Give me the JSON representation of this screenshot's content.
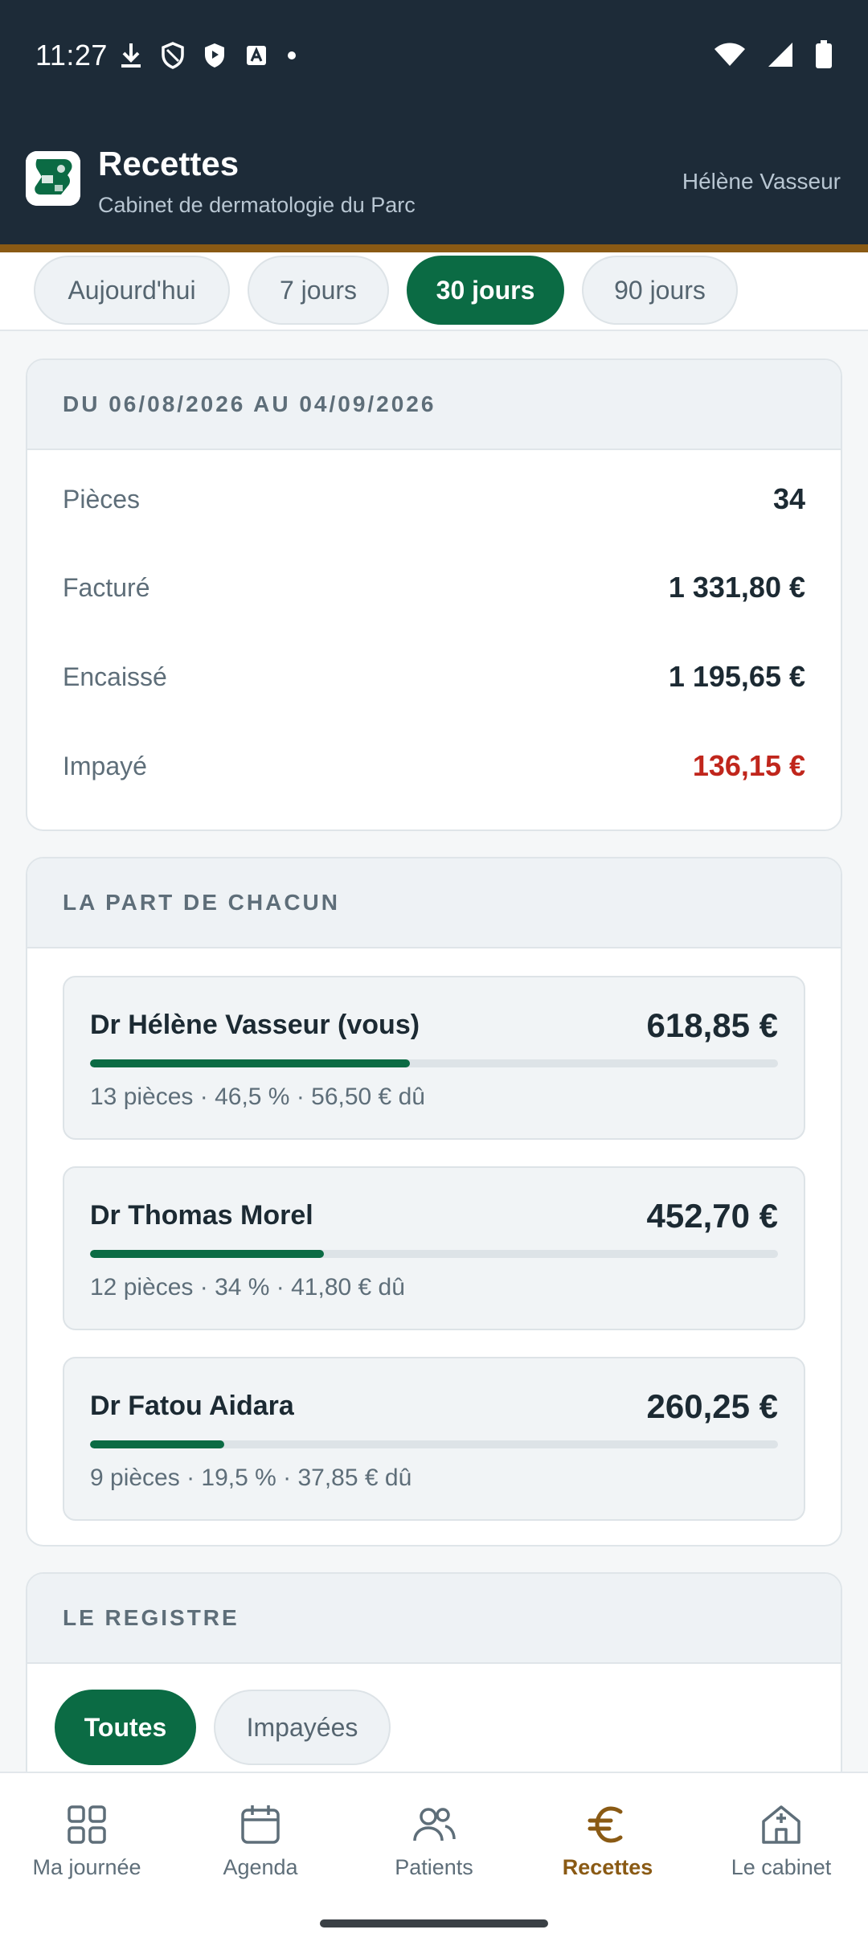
{
  "status_bar": {
    "time": "11:27"
  },
  "header": {
    "title": "Recettes",
    "subtitle": "Cabinet de dermatologie du Parc",
    "user": "Hélène Vasseur"
  },
  "periods": [
    {
      "label": "Aujourd'hui",
      "active": false
    },
    {
      "label": "7 jours",
      "active": false
    },
    {
      "label": "30 jours",
      "active": true
    },
    {
      "label": "90 jours",
      "active": false
    }
  ],
  "summary": {
    "heading": "DU 06/08/2026 AU 04/09/2026",
    "rows": [
      {
        "label": "Pièces",
        "value": "34"
      },
      {
        "label": "Facturé",
        "value": "1 331,80 €"
      },
      {
        "label": "Encaissé",
        "value": "1 195,65 €"
      },
      {
        "label": "Impayé",
        "value": "136,15 €"
      }
    ]
  },
  "shares": {
    "heading": "LA PART DE CHACUN",
    "items": [
      {
        "name": "Dr Hélène Vasseur (vous)",
        "amount": "618,85 €",
        "meta": "13 pièces · 46,5 % · 56,50 € dû",
        "fraction": 0.465
      },
      {
        "name": "Dr Thomas Morel",
        "amount": "452,70 €",
        "meta": "12 pièces · 34 % · 41,80 € dû",
        "fraction": 0.34
      },
      {
        "name": "Dr Fatou Aidara",
        "amount": "260,25 €",
        "meta": "9 pièces · 19,5 % · 37,85 € dû",
        "fraction": 0.195
      }
    ]
  },
  "register": {
    "heading": "LE REGISTRE",
    "filters": [
      {
        "label": "Toutes",
        "active": true
      },
      {
        "label": "Impayées",
        "active": false
      }
    ]
  },
  "nav": [
    {
      "label": "Ma journée",
      "icon": "grid-icon",
      "active": false
    },
    {
      "label": "Agenda",
      "icon": "calendar-icon",
      "active": false
    },
    {
      "label": "Patients",
      "icon": "people-icon",
      "active": false
    },
    {
      "label": "Recettes",
      "icon": "euro-icon",
      "active": true
    },
    {
      "label": "Le cabinet",
      "icon": "building-icon",
      "active": false
    }
  ],
  "colors": {
    "primary": "#0b6b44",
    "accent": "#8a5a14",
    "header_bg": "#1d2b38",
    "danger": "#c0261c"
  }
}
